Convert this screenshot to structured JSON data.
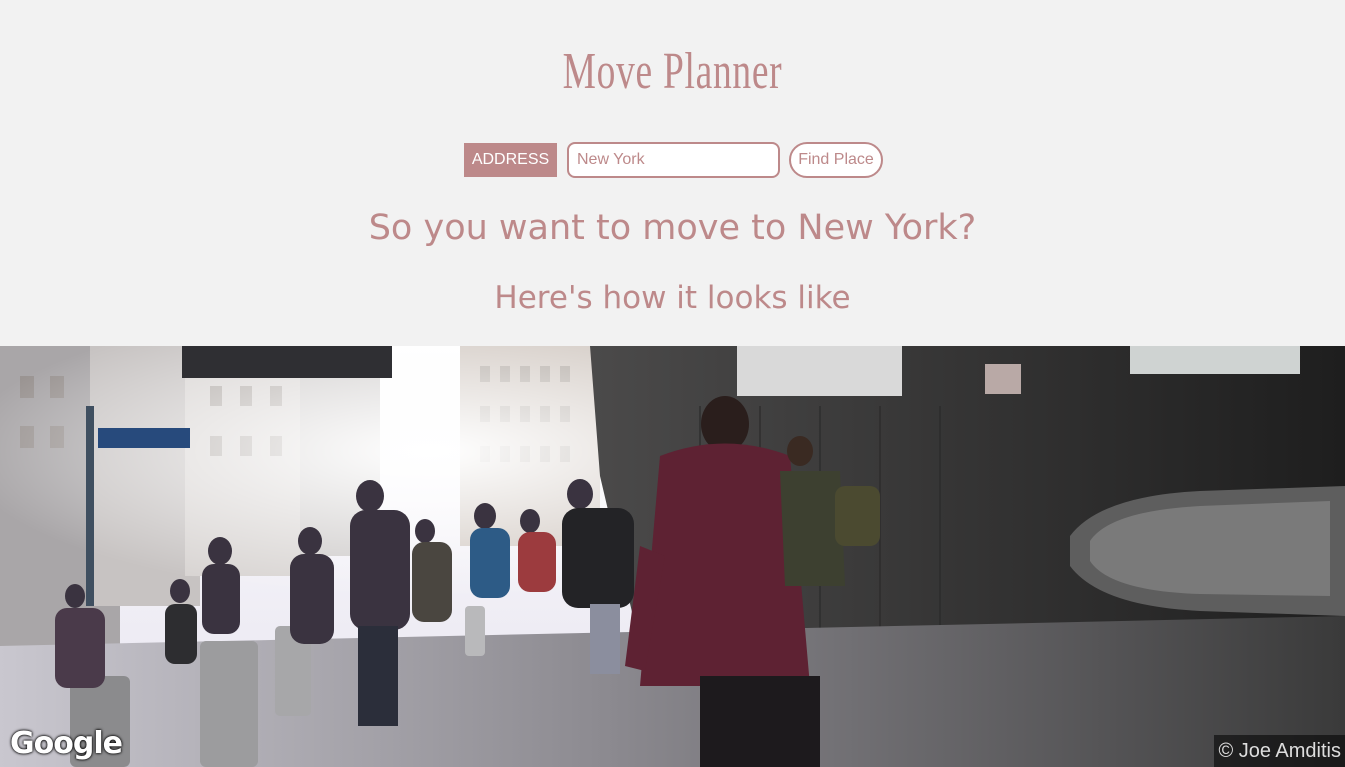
{
  "app": {
    "title": "Move Planner"
  },
  "form": {
    "address_label": "ADDRESS",
    "address_value": "New York",
    "find_button_label": "Find Place"
  },
  "results": {
    "greeting": "So you want to move to New York?",
    "subheading": "Here's how it looks like"
  },
  "streetview": {
    "logo_text": "Google",
    "attribution": "© Joe Amditis"
  },
  "colors": {
    "accent": "#bd898a",
    "background": "#f2f2f2"
  }
}
